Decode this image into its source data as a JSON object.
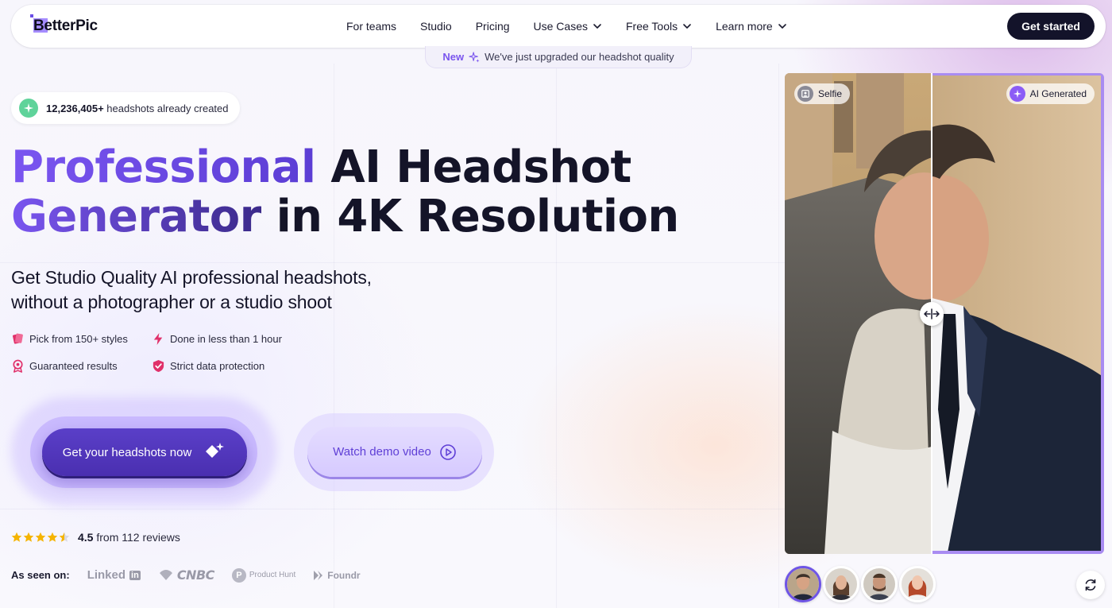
{
  "brand": {
    "name": "BetterPic"
  },
  "nav": {
    "items": [
      {
        "label": "For teams",
        "dropdown": false
      },
      {
        "label": "Studio",
        "dropdown": false
      },
      {
        "label": "Pricing",
        "dropdown": false
      },
      {
        "label": "Use Cases",
        "dropdown": true
      },
      {
        "label": "Free Tools",
        "dropdown": true
      },
      {
        "label": "Learn more",
        "dropdown": true
      }
    ],
    "cta_label": "Get started"
  },
  "announcement": {
    "badge": "New",
    "text": "We've just upgraded our headshot quality"
  },
  "counter": {
    "value": "12,236,405+",
    "text": "headshots already created"
  },
  "hero": {
    "title_line1_highlight": "Professional",
    "title_line1_rest": "AI Headshot",
    "title_line2_highlight": "Generator",
    "title_line2_rest": "in 4K Resolution",
    "subtitle_line1": "Get Studio Quality AI professional headshots,",
    "subtitle_line2": "without a photographer or a studio shoot"
  },
  "features": [
    {
      "icon": "cards-icon",
      "label": "Pick from 150+ styles"
    },
    {
      "icon": "lightning-icon",
      "label": "Done in less than 1 hour"
    },
    {
      "icon": "badge-icon",
      "label": "Guaranteed results"
    },
    {
      "icon": "shield-check-icon",
      "label": "Strict data protection"
    }
  ],
  "buttons": {
    "primary": "Get your headshots now",
    "secondary": "Watch demo video"
  },
  "reviews": {
    "rating": 4.5,
    "rating_text": "4.5",
    "text": "from 112 reviews",
    "stars": 5
  },
  "press": {
    "label": "As seen on:",
    "logos": {
      "linkedin": "Linked",
      "linkedin_box": "in",
      "cnbc": "CNBC",
      "producthunt": "Product Hunt",
      "producthunt_letter": "P",
      "foundr": "Foundr"
    }
  },
  "comparison": {
    "left_label": "Selfie",
    "right_label": "AI Generated",
    "split": 0.46
  },
  "thumbnails": {
    "count": 4,
    "active_index": 0
  },
  "colors": {
    "accent": "#7a55f0",
    "dark": "#13132a",
    "star": "#f5b400",
    "feature_icon": "#e0306a"
  }
}
